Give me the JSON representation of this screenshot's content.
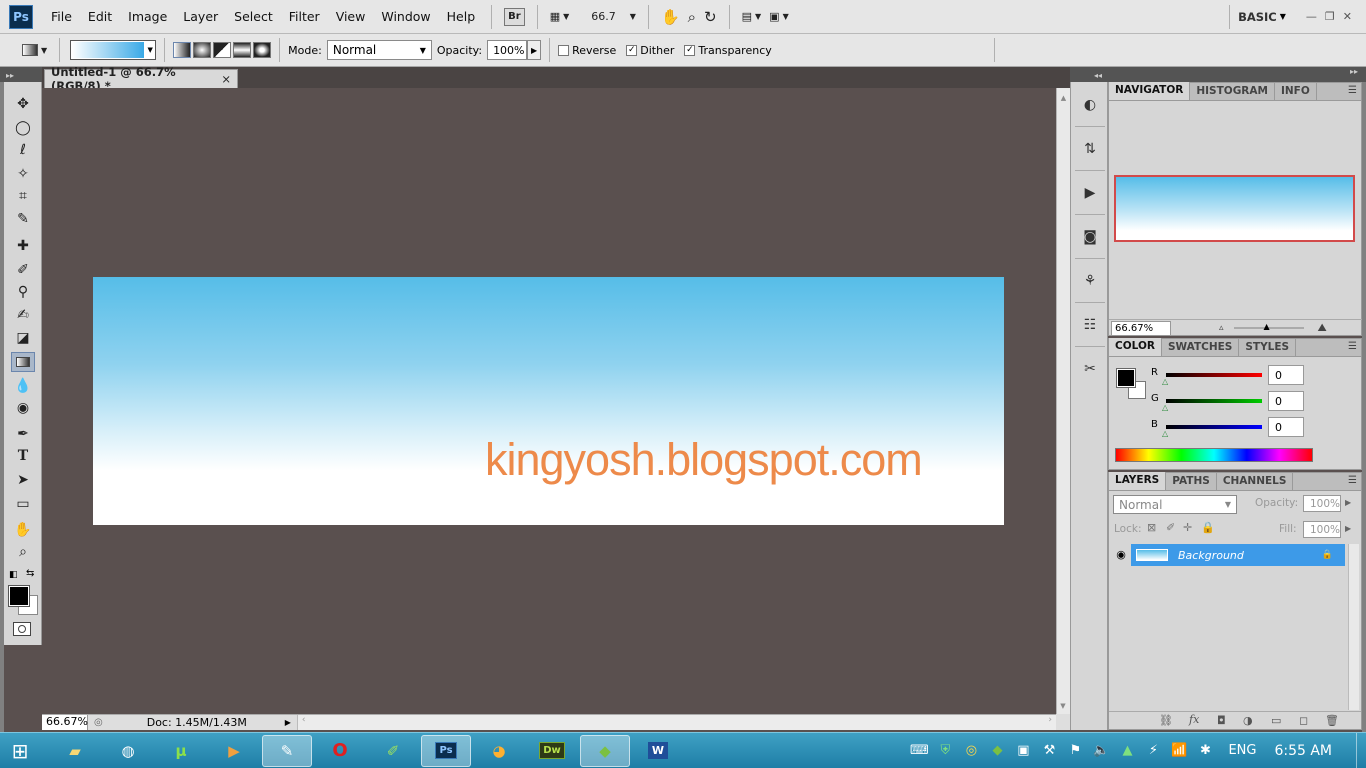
{
  "menubar": {
    "logo": "Ps",
    "items": [
      "File",
      "Edit",
      "Image",
      "Layer",
      "Select",
      "Filter",
      "View",
      "Window",
      "Help"
    ],
    "bridge": "Br",
    "zoom": "66.7",
    "workspace": "BASIC"
  },
  "options": {
    "mode_label": "Mode:",
    "mode_value": "Normal",
    "opacity_label": "Opacity:",
    "opacity_value": "100%",
    "reverse_label": "Reverse",
    "reverse_checked": false,
    "dither_label": "Dither",
    "dither_checked": true,
    "transparency_label": "Transparency",
    "transparency_checked": true
  },
  "document": {
    "tab_title": "Untitled-1 @ 66.7% (RGB/8) *",
    "close": "×",
    "canvas_text": "kingyosh.blogspot.com",
    "gradient_colors": [
      "#56bde8",
      "#ffffff"
    ]
  },
  "status": {
    "zoom": "66.67%",
    "doc": "Doc: 1.45M/1.43M"
  },
  "navigator": {
    "tabs": [
      "NAVIGATOR",
      "HISTOGRAM",
      "INFO"
    ],
    "zoom": "66.67%"
  },
  "color": {
    "tabs": [
      "COLOR",
      "SWATCHES",
      "STYLES"
    ],
    "r_label": "R",
    "r_value": "0",
    "g_label": "G",
    "g_value": "0",
    "b_label": "B",
    "b_value": "0"
  },
  "layers": {
    "tabs": [
      "LAYERS",
      "PATHS",
      "CHANNELS"
    ],
    "blend": "Normal",
    "opacity_label": "Opacity:",
    "opacity_value": "100%",
    "lock_label": "Lock:",
    "fill_label": "Fill:",
    "fill_value": "100%",
    "layer_name": "Background"
  },
  "taskbar": {
    "apps": [
      "Explorer",
      "Chrome",
      "uTorrent",
      "Media",
      "Paint",
      "Opera",
      "Notepad",
      "Photoshop",
      "Firefox",
      "Dreamweaver",
      "Minecraft",
      "Word"
    ],
    "active_app": "Photoshop",
    "language": "ENG",
    "time": "6:55 AM"
  },
  "colors": {
    "accent": "#3d9ae8",
    "taskbar": "#2b8fb8",
    "watermark": "#ed8a4a"
  }
}
